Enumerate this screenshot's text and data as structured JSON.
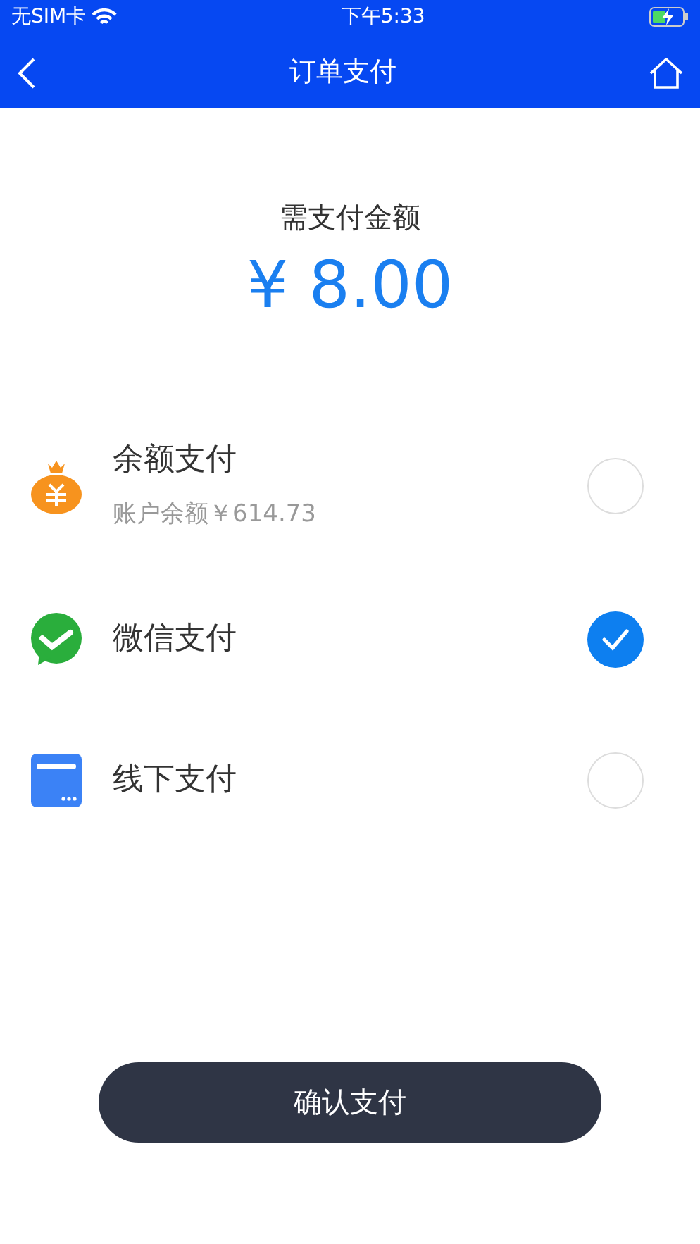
{
  "status_bar": {
    "carrier": "无SIM卡",
    "time": "下午5:33",
    "battery_charging": true
  },
  "nav": {
    "title": "订单支付"
  },
  "amount": {
    "label": "需支付金额",
    "value": "¥ 8.00"
  },
  "methods": [
    {
      "kind": "bag",
      "name": "余额支付",
      "note": "账户余额￥614.73",
      "selected": false
    },
    {
      "kind": "wechat",
      "name": "微信支付",
      "selected": true
    },
    {
      "kind": "card",
      "name": "线下支付",
      "selected": false
    }
  ],
  "confirm_button": "确认支付"
}
